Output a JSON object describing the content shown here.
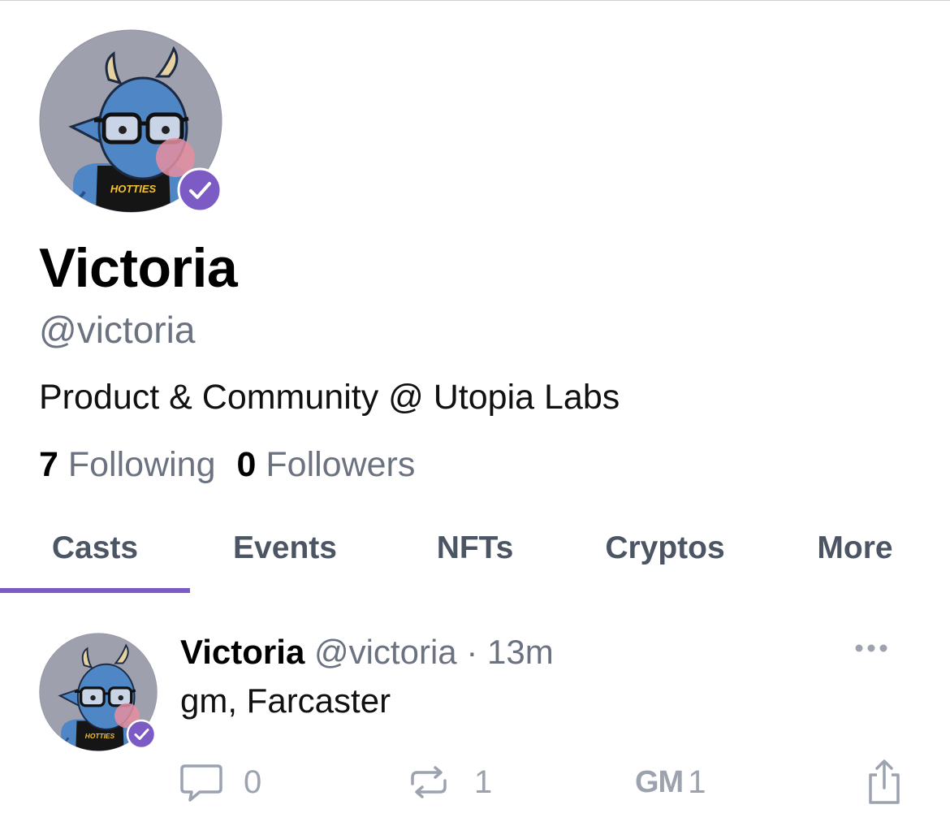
{
  "profile": {
    "display_name": "Victoria",
    "handle": "@victoria",
    "bio": "Product & Community @ Utopia Labs",
    "following_count": "7",
    "following_label": "Following",
    "followers_count": "0",
    "followers_label": "Followers",
    "avatar_shirt_text": "HOTTIES"
  },
  "tabs": [
    {
      "label": "Casts",
      "active": true
    },
    {
      "label": "Events",
      "active": false
    },
    {
      "label": "NFTs",
      "active": false
    },
    {
      "label": "Cryptos",
      "active": false
    },
    {
      "label": "More",
      "active": false
    }
  ],
  "cast": {
    "author_name": "Victoria",
    "author_handle": "@victoria",
    "separator": "·",
    "timestamp": "13m",
    "text": "gm, Farcaster",
    "replies": "0",
    "recasts": "1",
    "gm_label": "GM",
    "gm_count": "1"
  },
  "icons": {
    "verified": "check-badge-icon",
    "more": "ellipsis-icon",
    "reply": "speech-bubble-icon",
    "recast": "recast-arrows-icon",
    "share": "share-icon"
  },
  "colors": {
    "accent": "#7c5cc4",
    "muted_text": "#6b7280",
    "icon_gray": "#9ca3af",
    "avatar_bg": "#9ea0ad",
    "avatar_skin": "#4f86c6"
  }
}
